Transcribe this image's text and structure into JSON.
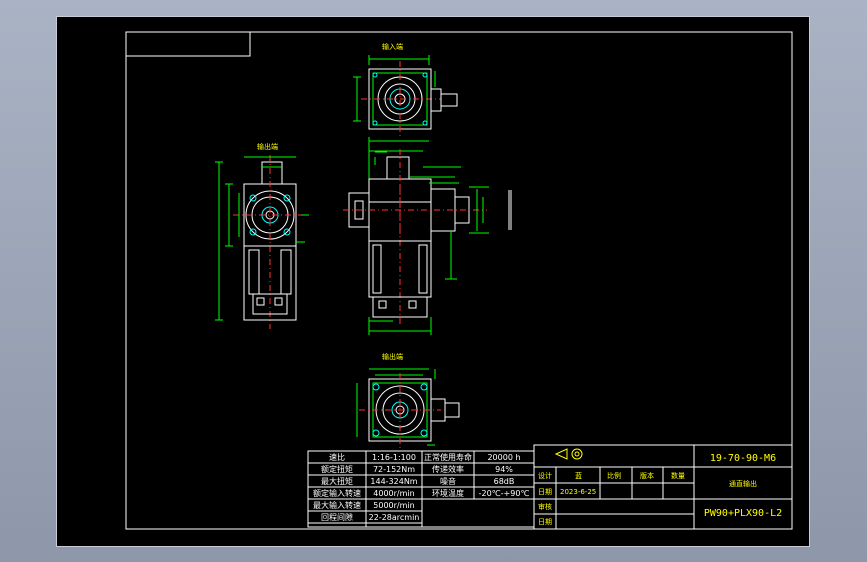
{
  "views": {
    "input_end_label": "输入端",
    "output_end_label_1": "输出端",
    "output_end_label_2": "输出端"
  },
  "spec_table": {
    "rows": [
      {
        "k1": "速比",
        "v1": "1:16-1:100",
        "k2": "正常使用寿命",
        "v2": "20000 h"
      },
      {
        "k1": "额定扭矩",
        "v1": "72-152Nm",
        "k2": "传递效率",
        "v2": "94%"
      },
      {
        "k1": "最大扭矩",
        "v1": "144-324Nm",
        "k2": "噪音",
        "v2": "68dB"
      },
      {
        "k1": "额定输入转速",
        "v1": "4000r/min",
        "k2": "环境温度",
        "v2": "-20℃-+90℃"
      },
      {
        "k1": "最大输入转速",
        "v1": "5000r/min",
        "k2": "",
        "v2": ""
      },
      {
        "k1": "回程间隙",
        "v1": "22-28arcmin",
        "k2": "",
        "v2": ""
      }
    ]
  },
  "title_block": {
    "drawing_code": "19-70-90-M6",
    "description": "通直输出",
    "model": "PW90+PLX90-L2",
    "labels": {
      "design": "设计",
      "scale": "比例",
      "version": "版本",
      "quantity": "数量",
      "date": "日期",
      "review": "审核",
      "approve": "日期"
    },
    "designer_value": "蓝",
    "date_value": "2023-6-25"
  }
}
